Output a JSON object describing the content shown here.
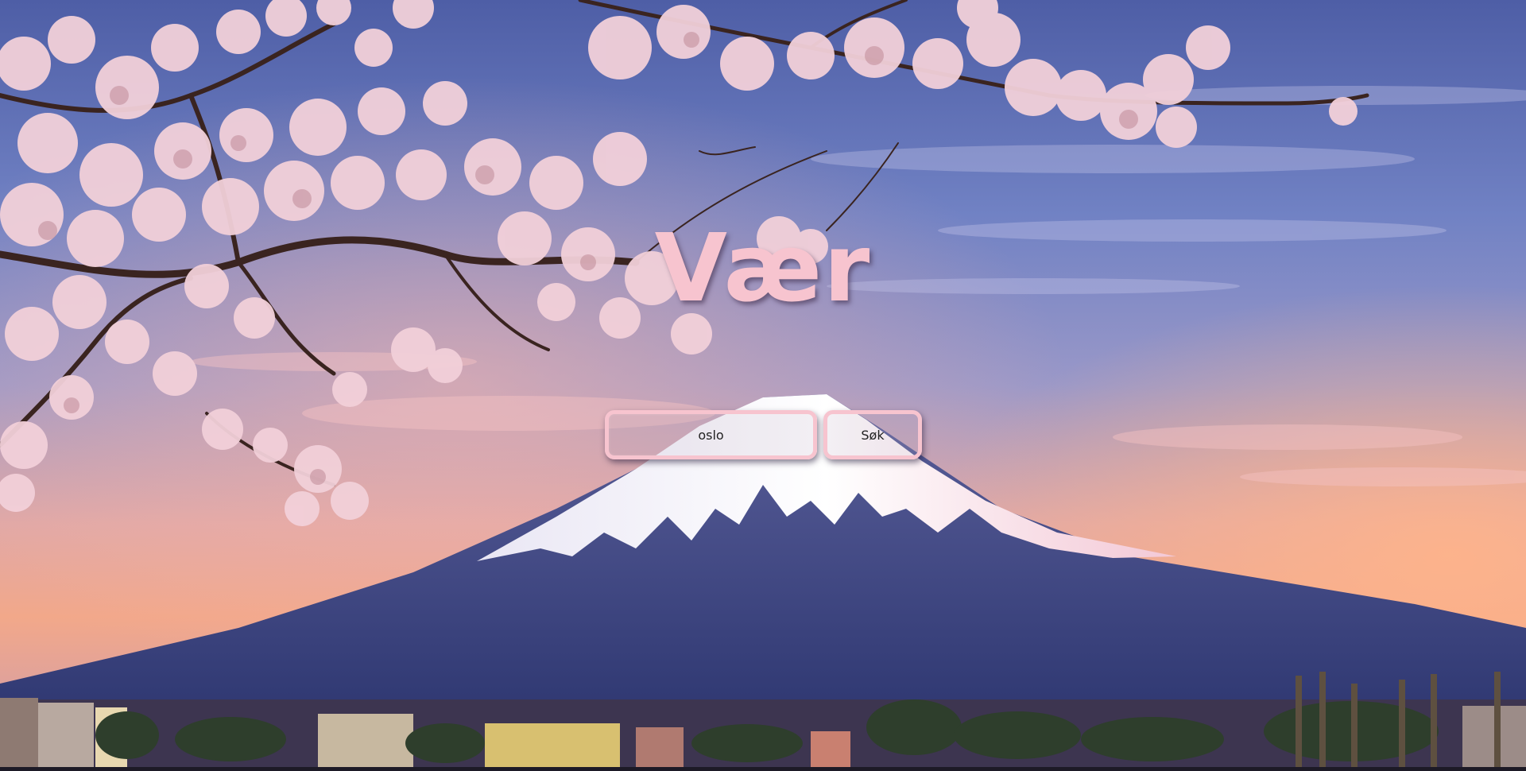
{
  "page": {
    "title": "Vær"
  },
  "search": {
    "value": "oslo",
    "button_label": "Søk"
  },
  "colors": {
    "accent_pink": "#f7c4cf",
    "sky_top": "#4a5aa0",
    "sunset_orange": "#f6a77e",
    "mountain_blue": "#3d4a8a",
    "blossom_pink": "#f3d3dc"
  }
}
